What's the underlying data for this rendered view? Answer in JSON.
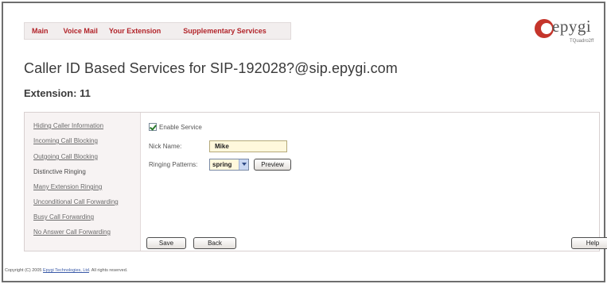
{
  "nav": {
    "items": [
      "Main",
      "Voice Mail",
      "Your Extension",
      "Supplementary Services"
    ]
  },
  "logo": {
    "word": "epygi",
    "model": "TQuadro2ff"
  },
  "page": {
    "title": "Caller ID Based Services for SIP-192028?@sip.epygi.com",
    "extension": "Extension: 11"
  },
  "sidebar": {
    "items": [
      {
        "label": "Hiding Caller Information"
      },
      {
        "label": "Incoming Call Blocking"
      },
      {
        "label": "Outgoing Call Blocking"
      },
      {
        "label": "Distinctive Ringing"
      },
      {
        "label": "Many Extension Ringing"
      },
      {
        "label": "Unconditional Call Forwarding"
      },
      {
        "label": "Busy Call Forwarding"
      },
      {
        "label": "No Answer Call Forwarding"
      }
    ]
  },
  "form": {
    "enable_label": "Enable Service",
    "enable_checked": true,
    "nick_label": "Nick Name:",
    "nick_value": "Mike",
    "pattern_label": "Ringing Patterns:",
    "pattern_value": "spring",
    "preview_label": "Preview"
  },
  "buttons": {
    "save": "Save",
    "back": "Back",
    "help": "Help"
  },
  "footer": {
    "prefix": "Copyright (C) 2005 ",
    "company": "Epygi Technologies, Ltd",
    "suffix": ". All rights reserved."
  },
  "colors": {
    "nav_link": "#b2242a",
    "logo_red": "#c5352b",
    "input_bg": "#fff8dc"
  }
}
